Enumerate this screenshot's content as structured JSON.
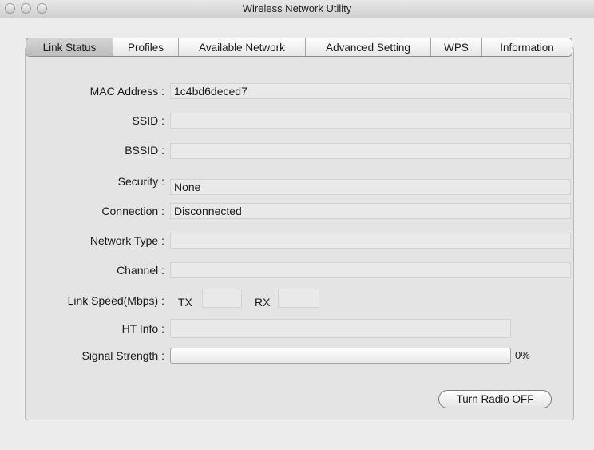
{
  "window": {
    "title": "Wireless Network Utility"
  },
  "tabs": [
    {
      "label": "Link Status",
      "active": true
    },
    {
      "label": "Profiles"
    },
    {
      "label": "Available Network"
    },
    {
      "label": "Advanced Setting"
    },
    {
      "label": "WPS"
    },
    {
      "label": "Information"
    }
  ],
  "fields": {
    "mac": {
      "label": "MAC Address :",
      "value": "1c4bd6deced7"
    },
    "ssid": {
      "label": "SSID :",
      "value": ""
    },
    "bssid": {
      "label": "BSSID :",
      "value": ""
    },
    "security": {
      "label": "Security :",
      "value": "None"
    },
    "connection": {
      "label": "Connection :",
      "value": "Disconnected"
    },
    "network_type": {
      "label": "Network Type :",
      "value": ""
    },
    "channel": {
      "label": "Channel :",
      "value": ""
    },
    "link_speed": {
      "label": "Link Speed(Mbps) :",
      "tx_label": "TX",
      "tx_value": "",
      "rx_label": "RX",
      "rx_value": ""
    },
    "ht_info": {
      "label": "HT Info :",
      "value": ""
    },
    "signal": {
      "label": "Signal Strength :",
      "percent_text": "0%",
      "level": 0
    }
  },
  "buttons": {
    "radio": "Turn Radio OFF"
  }
}
